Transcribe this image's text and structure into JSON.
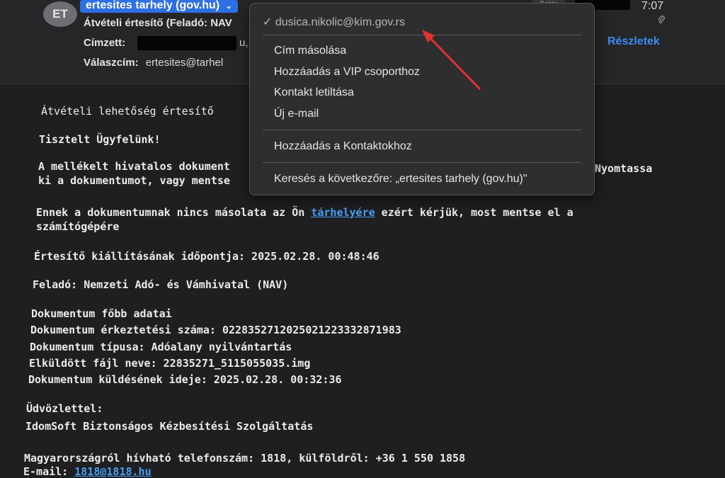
{
  "header": {
    "avatar_initials": "ET",
    "sender_name": "ertesites tarhely (gov.hu)",
    "sender_caret": "⌄",
    "subject": "Átvételi értesítő (Feladó: NAV",
    "to_label": "Címzett:",
    "to_suffix": "u,",
    "reply_to_label": "Válaszcím:",
    "reply_to_value": "ertesites@tarhel",
    "time": "7:07",
    "details_link": "Részletek",
    "reply_button": "Rejtés"
  },
  "menu": {
    "selected_address": "dusica.nikolic@kim.gov.rs",
    "check_mark": "✓",
    "items": [
      "Cím másolása",
      "Hozzáadás a VIP csoporthoz",
      "Kontakt letiltása",
      "Új e-mail"
    ],
    "add_contacts": "Hozzáadás a Kontaktokhoz",
    "search_label": "Keresés a következőre: „ertesites tarhely (gov.hu)\""
  },
  "body": {
    "heading": "Átvételi lehetőség értesítő",
    "greeting": "Tisztelt Ügyfelünk!",
    "p1_line1_left": "A mellékelt hivatalos dokument",
    "p1_line1_right": "Nyomtassa",
    "p1_line2": "ki a dokumentumot, vagy mentse",
    "p2_prefix": "Ennek a dokumentumnak nincs másolata az Ön ",
    "p2_link": "tárhelyére",
    "p2_suffix": " ezért kérjük, most mentse el a",
    "p2_line2": "számítógépére",
    "issued_label": "Értesítő kiállításának időpontja:",
    "issued_value": "2025.02.28. 00:48:46",
    "sender_label": "Feladó:",
    "sender_org": "Nemzeti Adó- és Vámhivatal",
    "sender_abbr": "(NAV)",
    "doc_title": "Dokumentum főbb adatai",
    "doc_arrival_label": "Dokumentum érkeztetési száma:",
    "doc_arrival_value": "0228352712025021223332871983",
    "doc_type_label": "Dokumentum típusa:",
    "doc_type_value": "Adóalany nyilvántartás",
    "file_label": "Elküldött fájl neve:",
    "file_value": "22835271_5115055035.img",
    "sent_label": "Dokumentum küldésének ideje:",
    "sent_value": "2025.02.28. 00:32:36",
    "closing": "Üdvözlettel:",
    "signature": "IdomSoft Biztonságos Kézbesítési Szolgáltatás",
    "phone_line": "Magyarországról hívható telefonszám: 1818, külföldről: +36 1 550 1858",
    "email_label": "E-mail:",
    "email_link": "1818@1818.hu"
  }
}
